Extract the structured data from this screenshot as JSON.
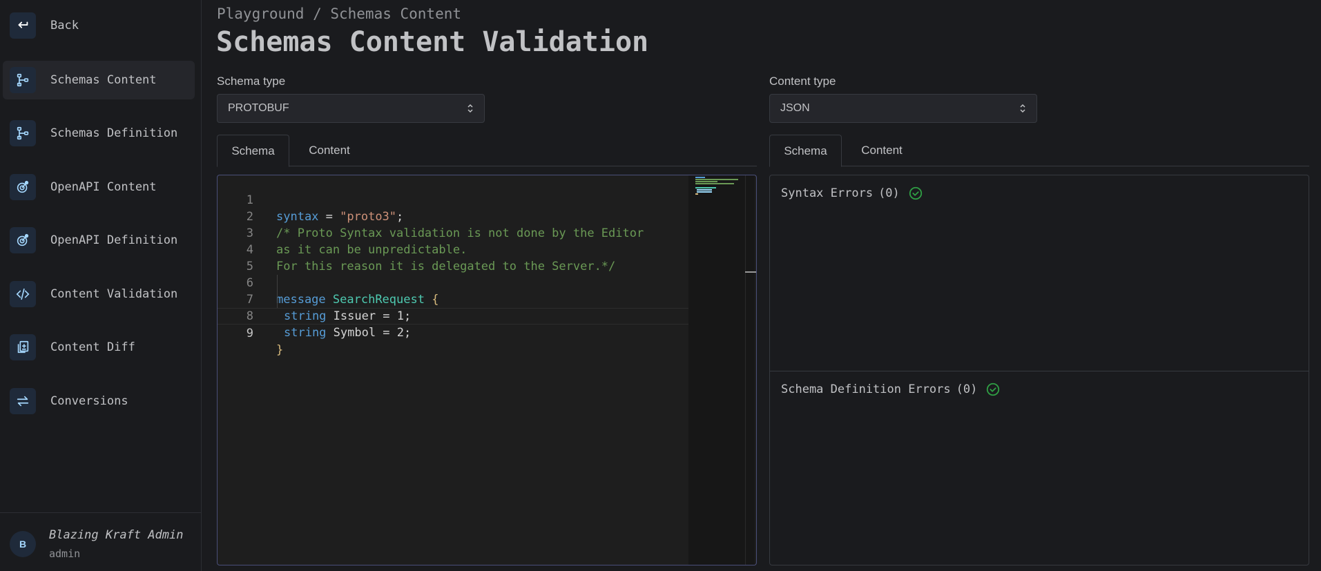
{
  "sidebar": {
    "back_label": "Back",
    "items": [
      {
        "label": "Schemas Content",
        "icon": "schema-tree-icon",
        "active": true
      },
      {
        "label": "Schemas Definition",
        "icon": "schema-tree-icon"
      },
      {
        "label": "OpenAPI Content",
        "icon": "openapi-icon"
      },
      {
        "label": "OpenAPI Definition",
        "icon": "openapi-icon"
      },
      {
        "label": "Content Validation",
        "icon": "code-icon"
      },
      {
        "label": "Content Diff",
        "icon": "file-diff-icon"
      },
      {
        "label": "Conversions",
        "icon": "arrows-exchange-icon"
      }
    ],
    "user": {
      "initial": "B",
      "name": "Blazing Kraft Admin",
      "role": "admin"
    }
  },
  "header": {
    "breadcrumb": "Playground / Schemas Content",
    "title": "Schemas Content Validation"
  },
  "left": {
    "select_label": "Schema type",
    "select_value": "PROTOBUF",
    "tabs": [
      "Schema",
      "Content"
    ],
    "active_tab": "Schema"
  },
  "right": {
    "select_label": "Content type",
    "select_value": "JSON",
    "tabs": [
      "Schema",
      "Content"
    ],
    "active_tab": "Schema",
    "syntax_errors_label": "Syntax Errors",
    "syntax_errors_count": "(0)",
    "schema_errors_label": "Schema Definition Errors",
    "schema_errors_count": "(0)"
  },
  "editor": {
    "line_numbers": [
      "1",
      "2",
      "3",
      "4",
      "5",
      "6",
      "7",
      "8",
      "9"
    ],
    "tokens": {
      "l1_kw": "syntax",
      "l1_eq": " = ",
      "l1_str": "\"proto3\"",
      "l1_semi": ";",
      "l2": "/* Proto Syntax validation is not done by the Editor",
      "l3": "as it can be unpredictable.",
      "l4": "For this reason it is delegated to the Server.*/",
      "l6_kw": "message",
      "l6_type": "SearchRequest",
      "l6_brace": "{",
      "l7_kw": "string",
      "l7_rest": " Issuer = 1;",
      "l8_kw": "string",
      "l8_rest": " Symbol = 2;",
      "l9_brace": "}"
    }
  },
  "colors": {
    "accent": "#a5d8ff",
    "success": "#2f9e44",
    "background": "#1a1b1e"
  }
}
